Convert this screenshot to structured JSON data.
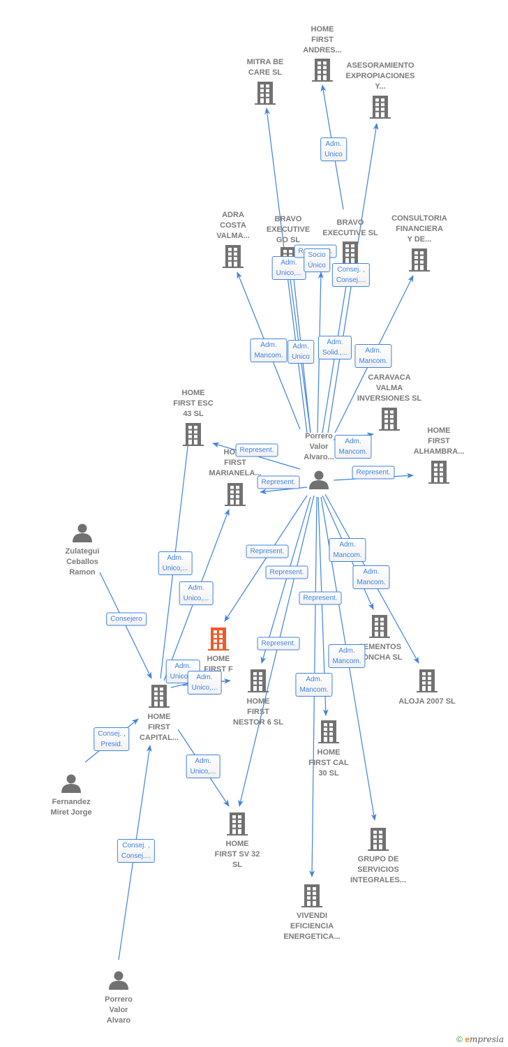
{
  "colors": {
    "edge": "#3f82e0",
    "node": "#717171",
    "focus": "#f05a28"
  },
  "nodes": [
    {
      "id": "andres",
      "type": "company",
      "label": [
        "HOME",
        "FIRST",
        "ANDRES..."
      ]
    },
    {
      "id": "mitra",
      "type": "company",
      "label": [
        "MITRA BE",
        "CARE  SL"
      ]
    },
    {
      "id": "asesor",
      "type": "company",
      "label": [
        "ASESORAMIENTO",
        "EXPROPIACIONES",
        "Y..."
      ]
    },
    {
      "id": "adra",
      "type": "company",
      "label": [
        "ADRA",
        "COSTA",
        "VALMA..."
      ]
    },
    {
      "id": "bravogo",
      "type": "company",
      "label": [
        "BRAVO",
        "EXECUTIVE",
        "GO  SL"
      ]
    },
    {
      "id": "bravo",
      "type": "company",
      "label": [
        "BRAVO",
        "EXECUTIVE SL"
      ]
    },
    {
      "id": "consult",
      "type": "company",
      "label": [
        "CONSULTORIA",
        "FINANCIERA",
        "Y DE..."
      ]
    },
    {
      "id": "caravaca",
      "type": "company",
      "label": [
        "CARAVACA",
        "VALMA",
        "INVERSIONES SL"
      ]
    },
    {
      "id": "esc",
      "type": "company",
      "label": [
        "HOME",
        "FIRST ESC",
        "43  SL"
      ]
    },
    {
      "id": "alhambra",
      "type": "company",
      "label": [
        "HOME",
        "FIRST",
        "ALHAMBRA..."
      ]
    },
    {
      "id": "marianela",
      "type": "company",
      "label": [
        "HOME",
        "FIRST",
        "MARIANELA..."
      ]
    },
    {
      "id": "center",
      "type": "person",
      "label": [
        "Porrero",
        "Valor",
        "Alvaro..."
      ]
    },
    {
      "id": "zulategui",
      "type": "person",
      "label": [
        "Zulategui",
        "Ceballos",
        "Ramon"
      ]
    },
    {
      "id": "focus",
      "type": "focus",
      "label": [
        "HOME",
        "FIRST F",
        "DE..."
      ]
    },
    {
      "id": "cementos",
      "type": "company",
      "label": [
        "CEMENTOS",
        "CONCHA SL"
      ]
    },
    {
      "id": "aloja",
      "type": "company",
      "label": [
        "ALOJA 2007 SL"
      ]
    },
    {
      "id": "nestor",
      "type": "company",
      "label": [
        "HOME",
        "FIRST",
        "NESTOR 6  SL"
      ]
    },
    {
      "id": "capital",
      "type": "company",
      "label": [
        "HOME",
        "FIRST",
        "CAPITAL..."
      ]
    },
    {
      "id": "cal30",
      "type": "company",
      "label": [
        "HOME",
        "FIRST CAL",
        "30  SL"
      ]
    },
    {
      "id": "fernandez",
      "type": "person",
      "label": [
        "Fernandez",
        "Miret Jorge"
      ]
    },
    {
      "id": "sv32",
      "type": "company",
      "label": [
        "HOME",
        "FIRST SV 32",
        "SL"
      ]
    },
    {
      "id": "grupo",
      "type": "company",
      "label": [
        "GRUPO DE",
        "SERVICIOS",
        "INTEGRALES..."
      ]
    },
    {
      "id": "vivendi",
      "type": "company",
      "label": [
        "VIVENDI",
        "EFICIENCIA",
        "ENERGETICA..."
      ]
    },
    {
      "id": "porrero2",
      "type": "person",
      "label": [
        "Porrero",
        "Valor",
        "Alvaro"
      ]
    }
  ],
  "edges": [
    {
      "from": "center",
      "to": "andres",
      "label": [
        "Adm.",
        "Unico"
      ]
    },
    {
      "from": "center",
      "to": "mitra",
      "label": [
        "Adm.",
        "Unico,..."
      ]
    },
    {
      "from": "center",
      "to": "asesor",
      "label": [
        "Consej. ,",
        "Consej...."
      ]
    },
    {
      "from": "center",
      "to": "bravogo",
      "label": [
        "Represent."
      ]
    },
    {
      "from": "center",
      "to": "bravo",
      "label": [
        "Socio",
        "Único"
      ]
    },
    {
      "from": "center",
      "to": "adra",
      "label": [
        "Adm.",
        "Mancom."
      ]
    },
    {
      "from": "center",
      "to": "bravogo",
      "label": [
        "Adm.",
        "Unico"
      ]
    },
    {
      "from": "center",
      "to": "bravo",
      "label": [
        "Adm.",
        "Solid.,..."
      ]
    },
    {
      "from": "center",
      "to": "consult",
      "label": [
        "Adm.",
        "Mancom."
      ]
    },
    {
      "from": "center",
      "to": "caravaca",
      "label": [
        "Adm.",
        "Mancom."
      ]
    },
    {
      "from": "center",
      "to": "esc",
      "label": [
        "Represent."
      ]
    },
    {
      "from": "center",
      "to": "alhambra",
      "label": [
        "Represent."
      ]
    },
    {
      "from": "center",
      "to": "marianela",
      "label": [
        "Represent."
      ]
    },
    {
      "from": "center",
      "to": "focus",
      "label": [
        "Represent."
      ]
    },
    {
      "from": "center",
      "to": "sv32",
      "label": [
        "Represent."
      ]
    },
    {
      "from": "center",
      "to": "cal30",
      "label": [
        "Represent."
      ]
    },
    {
      "from": "center",
      "to": "nestor",
      "label": [
        "Represent."
      ]
    },
    {
      "from": "center",
      "to": "cementos",
      "label": [
        "Adm.",
        "Mancom."
      ]
    },
    {
      "from": "center",
      "to": "aloja",
      "label": [
        "Adm.",
        "Mancom."
      ]
    },
    {
      "from": "center",
      "to": "grupo",
      "label": [
        "Adm.",
        "Mancom."
      ]
    },
    {
      "from": "center",
      "to": "vivendi",
      "label": [
        "Adm.",
        "Mancom."
      ]
    },
    {
      "from": "zulategui",
      "to": "capital",
      "label": [
        "Consejero"
      ]
    },
    {
      "from": "capital",
      "to": "esc",
      "label": [
        "Adm.",
        "Unico,..."
      ]
    },
    {
      "from": "capital",
      "to": "marianela",
      "label": [
        "Adm.",
        "Unico,..."
      ]
    },
    {
      "from": "capital",
      "to": "focus",
      "label": [
        "Adm.",
        "Unico,..."
      ]
    },
    {
      "from": "capital",
      "to": "focus",
      "label": [
        "Adm.",
        "Unico,..."
      ]
    },
    {
      "from": "capital",
      "to": "sv32",
      "label": [
        "Adm.",
        "Unico,..."
      ]
    },
    {
      "from": "fernandez",
      "to": "capital",
      "label": [
        "Consej. ,",
        "Presid."
      ]
    },
    {
      "from": "porrero2",
      "to": "capital",
      "label": [
        "Consej. ,",
        "Consej...."
      ]
    }
  ],
  "footer": {
    "copyright": "©",
    "brand": "mpresia",
    "brand_initial": "e"
  }
}
